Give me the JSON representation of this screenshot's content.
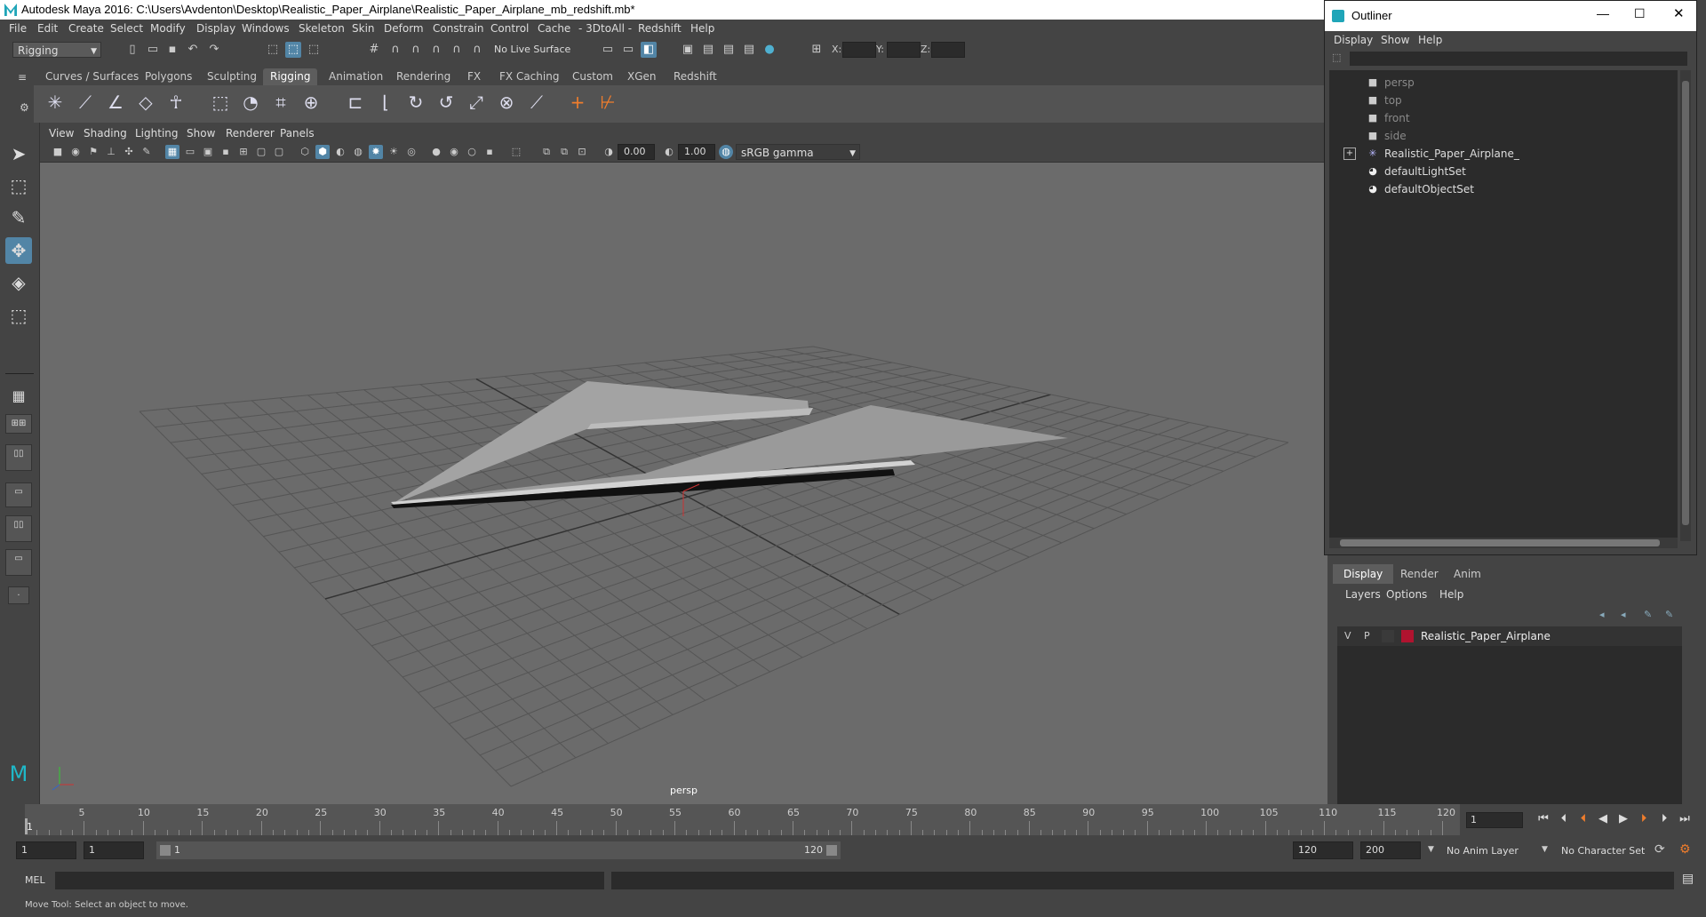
{
  "app": {
    "title": "Autodesk Maya 2016: C:\\Users\\Avdenton\\Desktop\\Realistic_Paper_Airplane\\Realistic_Paper_Airplane_mb_redshift.mb*"
  },
  "menubar": [
    "File",
    "Edit",
    "Create",
    "Select",
    "Modify",
    "Display",
    "Windows",
    "Skeleton",
    "Skin",
    "Deform",
    "Constrain",
    "Control",
    "Cache",
    "- 3DtoAll -",
    "Redshift",
    "Help"
  ],
  "statusline": {
    "mode": "Rigging",
    "live_surface": "No Live Surface",
    "x_label": "X:",
    "y_label": "Y:",
    "z_label": "Z:"
  },
  "shelf": {
    "tabs": [
      "Curves / Surfaces",
      "Polygons",
      "Sculpting",
      "Rigging",
      "Animation",
      "Rendering",
      "FX",
      "FX Caching",
      "Custom",
      "XGen",
      "Redshift"
    ],
    "active_tab": "Rigging"
  },
  "viewport": {
    "menu": [
      "View",
      "Shading",
      "Lighting",
      "Show",
      "Renderer",
      "Panels"
    ],
    "exposure": "0.00",
    "gamma": "1.00",
    "color_space": "sRGB gamma",
    "camera_label": "persp"
  },
  "outliner": {
    "title": "Outliner",
    "menu": [
      "Display",
      "Show",
      "Help"
    ],
    "items": [
      {
        "label": "persp",
        "type": "camera",
        "dim": true
      },
      {
        "label": "top",
        "type": "camera",
        "dim": true
      },
      {
        "label": "front",
        "type": "camera",
        "dim": true
      },
      {
        "label": "side",
        "type": "camera",
        "dim": true
      },
      {
        "label": "Realistic_Paper_Airplane_",
        "type": "group",
        "dim": false
      },
      {
        "label": "defaultLightSet",
        "type": "set",
        "dim": false
      },
      {
        "label": "defaultObjectSet",
        "type": "set",
        "dim": false
      }
    ]
  },
  "layer_editor": {
    "tabs": [
      "Display",
      "Render",
      "Anim"
    ],
    "active_tab": "Display",
    "menu": [
      "Layers",
      "Options",
      "Help"
    ],
    "layers": [
      {
        "visible": "V",
        "playback": "P",
        "color": "#b0132f",
        "name": "Realistic_Paper_Airplane"
      }
    ]
  },
  "timeline": {
    "ticks": [
      5,
      10,
      15,
      20,
      25,
      30,
      35,
      40,
      45,
      50,
      55,
      60,
      65,
      70,
      75,
      80,
      85,
      90,
      95,
      100,
      105,
      110,
      115,
      120
    ],
    "start_marker": "1",
    "current_frame": "1"
  },
  "range": {
    "start": "1",
    "playback_start": "1",
    "slider_start": "1",
    "slider_end": "120",
    "playback_end": "120",
    "end": "200",
    "anim_layer": "No Anim Layer",
    "character_set": "No Character Set"
  },
  "cmdline": {
    "label": "MEL"
  },
  "helpline": {
    "text": "Move Tool: Select an object to move."
  }
}
